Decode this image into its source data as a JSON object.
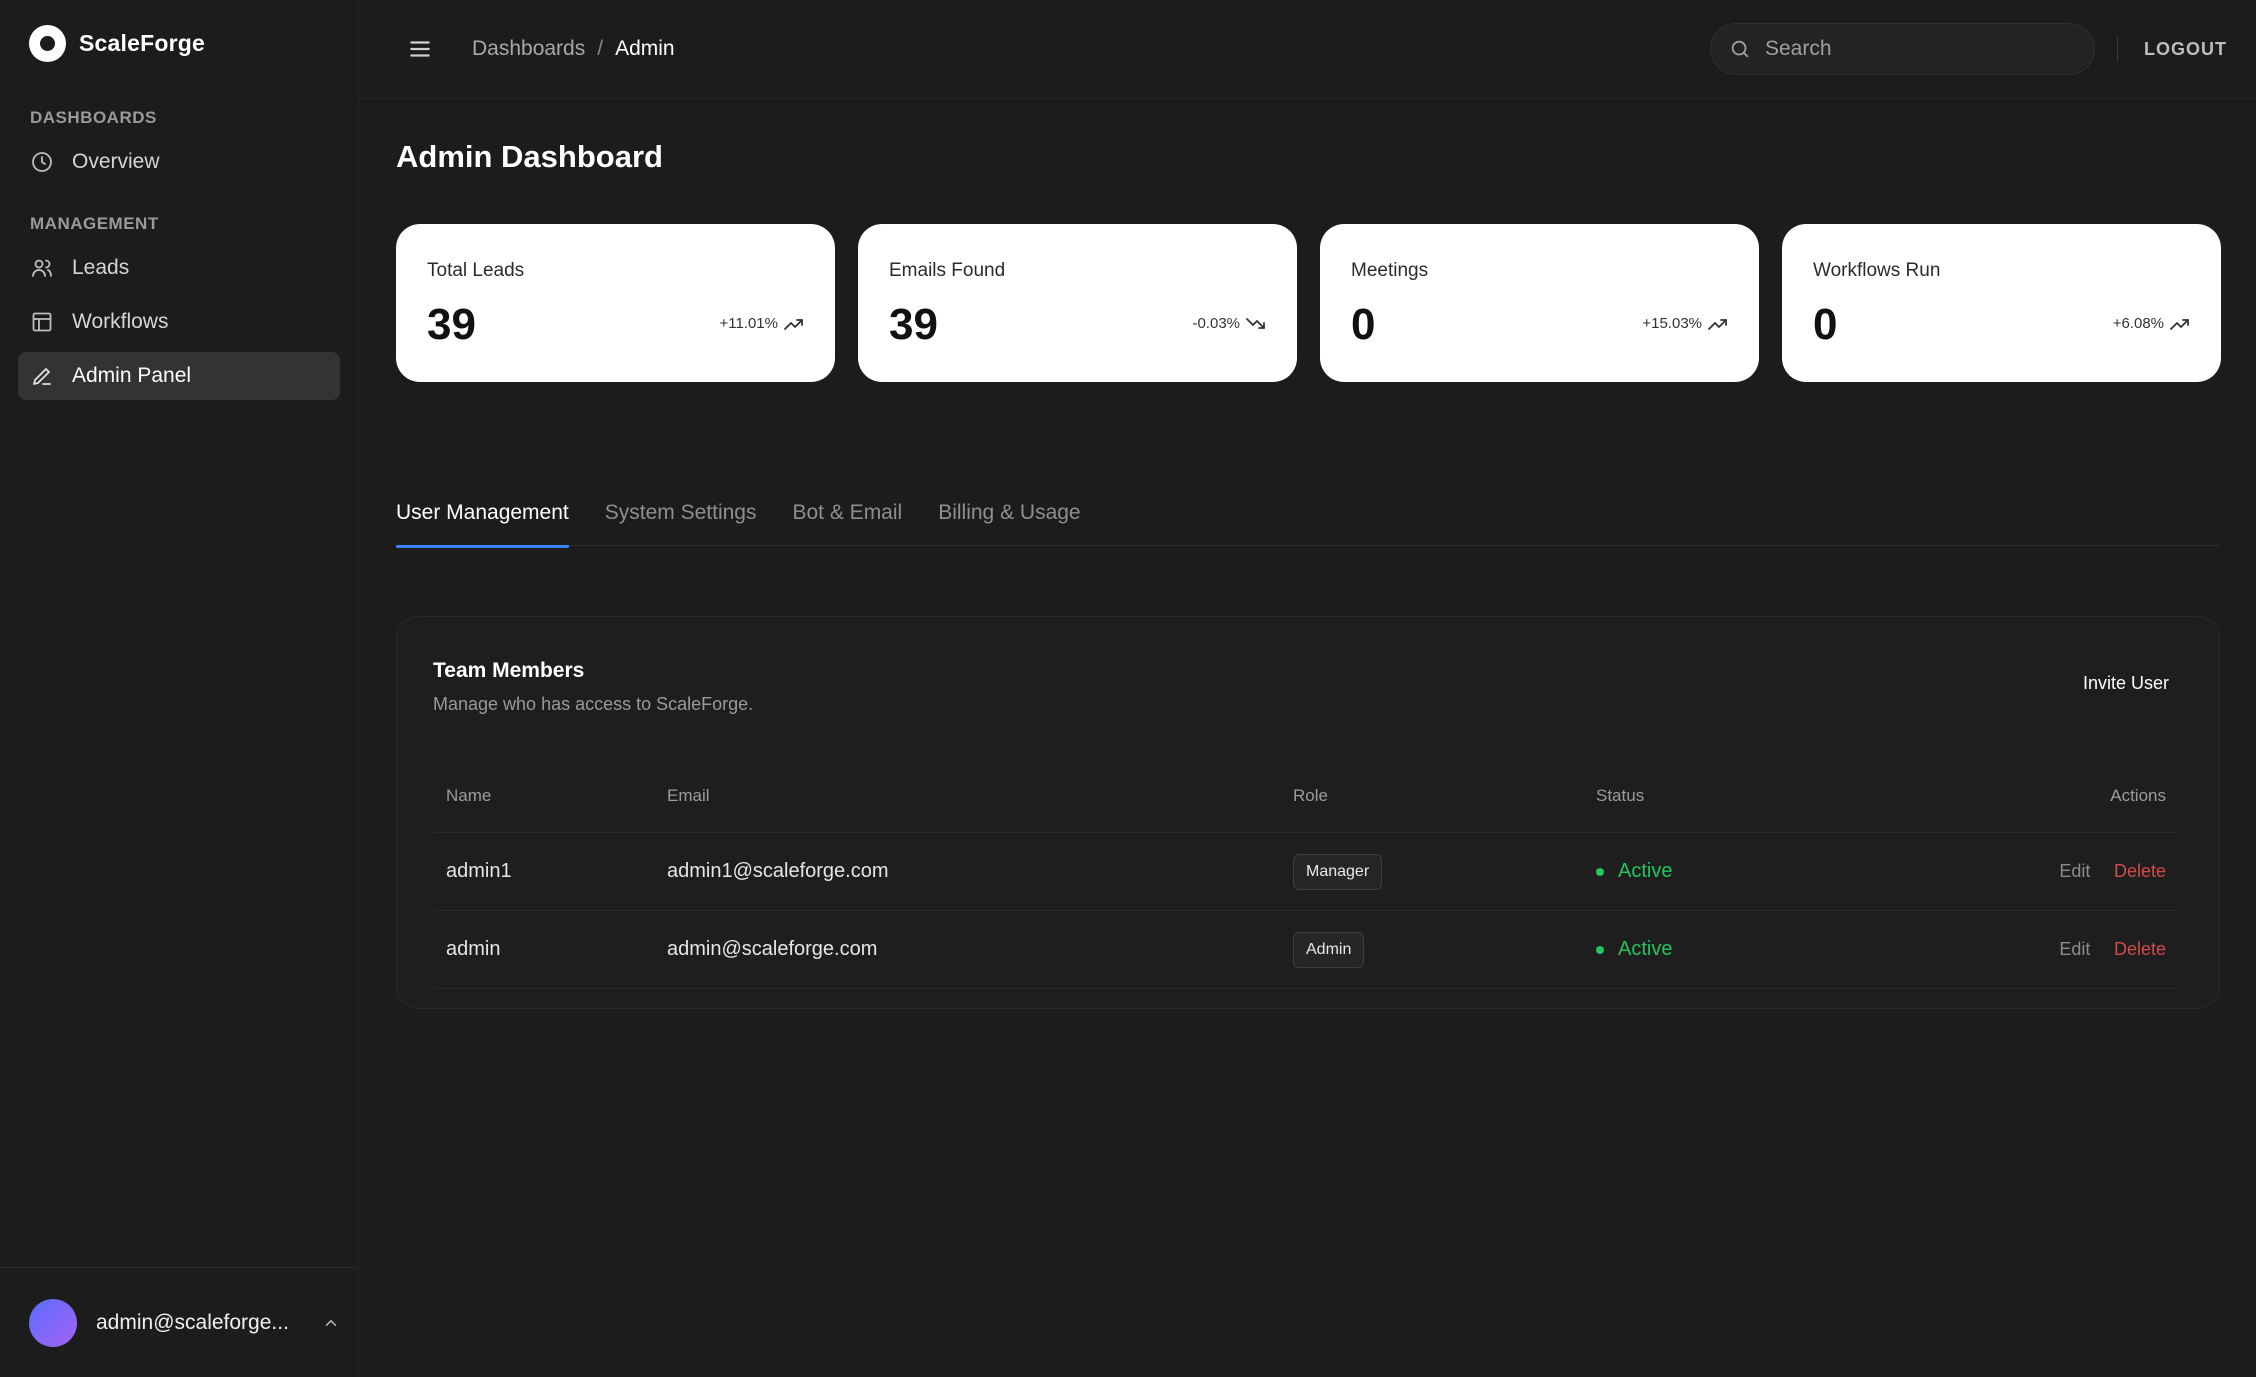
{
  "brand": {
    "name": "ScaleForge"
  },
  "sidebar": {
    "sections": [
      {
        "label": "DASHBOARDS",
        "items": [
          {
            "label": "Overview",
            "icon": "clock-icon",
            "active": false
          }
        ]
      },
      {
        "label": "MANAGEMENT",
        "items": [
          {
            "label": "Leads",
            "icon": "users-icon",
            "active": false
          },
          {
            "label": "Workflows",
            "icon": "layout-icon",
            "active": false
          },
          {
            "label": "Admin Panel",
            "icon": "pencil-icon",
            "active": true
          }
        ]
      }
    ],
    "user": {
      "email": "admin@scaleforge...",
      "avatar_gradient": [
        "#5a6bff",
        "#a464f2"
      ]
    }
  },
  "topbar": {
    "breadcrumb": {
      "parent": "Dashboards",
      "separator": "/",
      "current": "Admin"
    },
    "search": {
      "placeholder": "Search",
      "value": ""
    },
    "logout_label": "LOGOUT"
  },
  "page": {
    "title": "Admin Dashboard"
  },
  "stats": [
    {
      "label": "Total Leads",
      "value": "39",
      "change": "+11.01%",
      "trend": "up"
    },
    {
      "label": "Emails Found",
      "value": "39",
      "change": "-0.03%",
      "trend": "down"
    },
    {
      "label": "Meetings",
      "value": "0",
      "change": "+15.03%",
      "trend": "up"
    },
    {
      "label": "Workflows Run",
      "value": "0",
      "change": "+6.08%",
      "trend": "up"
    }
  ],
  "tabs": [
    {
      "label": "User Management",
      "active": true
    },
    {
      "label": "System Settings",
      "active": false
    },
    {
      "label": "Bot & Email",
      "active": false
    },
    {
      "label": "Billing & Usage",
      "active": false
    }
  ],
  "team": {
    "title": "Team Members",
    "subtitle": "Manage who has access to ScaleForge.",
    "invite_label": "Invite User",
    "columns": {
      "name": "Name",
      "email": "Email",
      "role": "Role",
      "status": "Status",
      "actions": "Actions"
    },
    "rows": [
      {
        "name": "admin1",
        "email": "admin1@scaleforge.com",
        "role": "Manager",
        "status": "Active",
        "edit": "Edit",
        "delete": "Delete"
      },
      {
        "name": "admin",
        "email": "admin@scaleforge.com",
        "role": "Admin",
        "status": "Active",
        "edit": "Edit",
        "delete": "Delete"
      }
    ]
  },
  "colors": {
    "accent": "#3b82f6",
    "success": "#22c55e",
    "danger": "#d44a4a",
    "background": "#1c1c1c"
  }
}
